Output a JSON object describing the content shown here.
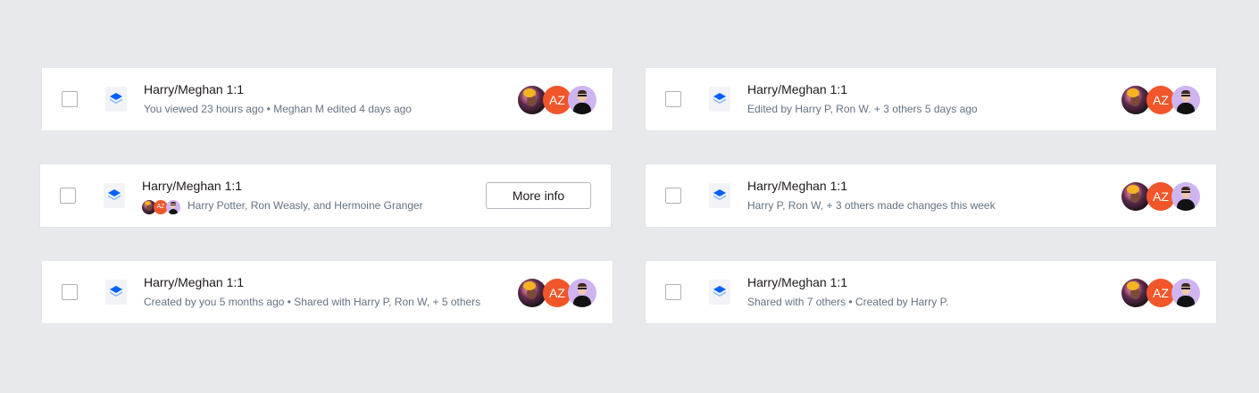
{
  "colors": {
    "background": "#e8e9ec",
    "card": "#ffffff",
    "title_text": "#1e1919",
    "meta_text": "#637282",
    "avatar_initials_bg": "#f1562a",
    "avatar_person_bg": "#cfb4f2",
    "file_icon_accent": "#0061fe"
  },
  "icons": {
    "file": "dropbox-paper-icon",
    "checkbox": "checkbox-icon"
  },
  "avatar_initials": "AZ",
  "rows": [
    {
      "title": "Harry/Meghan 1:1",
      "meta": "You viewed 23 hours ago • Meghan M edited 4 days ago"
    },
    {
      "title": "Harry/Meghan 1:1",
      "meta": "Harry Potter, Ron Weasly, and Hermoine Granger",
      "button_label": "More info"
    },
    {
      "title": "Harry/Meghan 1:1",
      "meta": "Created by you 5 months ago • Shared with Harry P, Ron W, + 5 others"
    },
    {
      "title": "Harry/Meghan 1:1",
      "meta": "Edited by Harry P, Ron W. + 3 others 5 days ago"
    },
    {
      "title": "Harry/Meghan 1:1",
      "meta": "Harry P, Ron W, + 3 others made changes this week"
    },
    {
      "title": "Harry/Meghan 1:1",
      "meta": "Shared with 7 others •  Created by Harry P."
    }
  ]
}
